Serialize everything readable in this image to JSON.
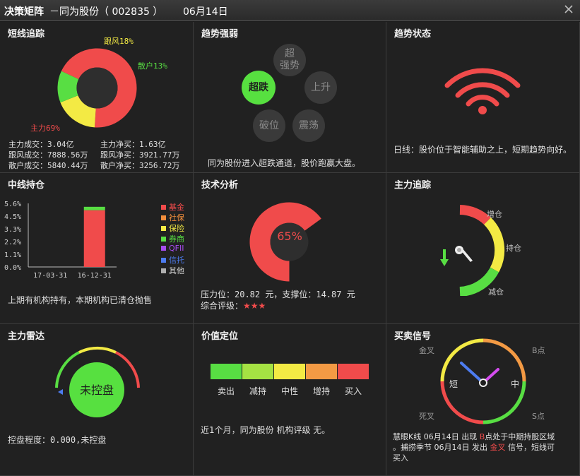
{
  "window": {
    "title": "决策矩阵",
    "stock": "－同为股份（ 002835 ）",
    "date": "06月14日"
  },
  "short_trend": {
    "title": "短线追踪",
    "slices": [
      {
        "name": "主力",
        "percent": 69,
        "label": "主力69%",
        "color": "#f04b4b"
      },
      {
        "name": "跟风",
        "percent": 18,
        "label": "跟风18%",
        "color": "#f3ea44"
      },
      {
        "name": "散户",
        "percent": 13,
        "label": "散户13%",
        "color": "#58de43"
      }
    ],
    "stats_left": [
      "主力成交：3.04亿",
      "跟风成交：7888.56万",
      "散户成交：5840.44万"
    ],
    "stats_right": [
      "主力净买：1.63亿",
      "跟风净买：3921.77万",
      "散户净买：3256.72万"
    ]
  },
  "trend_strength": {
    "title": "趋势强弱",
    "bubbles": {
      "super_strong": "超\n强势",
      "up": "上升",
      "super_down": "超跌",
      "break": "破位",
      "shock": "震荡"
    },
    "active": "super_down",
    "desc": "同为股份进入超跌通道，股价跑赢大盘。"
  },
  "trend_state": {
    "title": "趋势状态",
    "desc": "日线：股价位于智能辅助之上，短期趋势向好。",
    "signal_color": "#f04b4b"
  },
  "mid_position": {
    "title": "中线持仓",
    "yticks": [
      "5.6%",
      "4.5%",
      "3.3%",
      "2.2%",
      "1.1%",
      "0.0%"
    ],
    "desc": "上期有机构持有，本期机构已清仓抛售",
    "legend": [
      {
        "label": "基金",
        "color": "#f04b4b"
      },
      {
        "label": "社保",
        "color": "#f08d3c"
      },
      {
        "label": "保险",
        "color": "#f3ea44"
      },
      {
        "label": "券商",
        "color": "#58de43"
      },
      {
        "label": "QFII",
        "color": "#a64df0"
      },
      {
        "label": "信托",
        "color": "#4d7cf0"
      },
      {
        "label": "其他",
        "color": "#b0b0b0"
      }
    ]
  },
  "chart_data": {
    "type": "bar",
    "categories": [
      "17-03-31",
      "16-12-31"
    ],
    "series": [
      {
        "name": "基金",
        "values": [
          0,
          5.0
        ]
      },
      {
        "name": "券商",
        "values": [
          0,
          0.3
        ]
      }
    ],
    "ylim": [
      0,
      5.6
    ]
  },
  "tech_analysis": {
    "title": "技术分析",
    "percent": 65,
    "percent_label": "65%",
    "pressure": "压力位：20.82 元，支撑位：14.87 元",
    "rating_label": "综合评级：",
    "stars": "★★★"
  },
  "main_tracking": {
    "title": "主力追踪",
    "labels": {
      "add": "增仓",
      "hold": "持仓",
      "reduce": "减仓"
    },
    "arrow_color": "#58de43"
  },
  "main_radar": {
    "title": "主力雷达",
    "status": "未控盘",
    "desc": "控盘程度：0.000,未控盘"
  },
  "value_position": {
    "title": "价值定位",
    "scale": [
      {
        "label": "卖出",
        "color": "#58de43"
      },
      {
        "label": "减持",
        "color": "#a5e243"
      },
      {
        "label": "中性",
        "color": "#f3ea44"
      },
      {
        "label": "增持",
        "color": "#f39a44"
      },
      {
        "label": "买入",
        "color": "#f04b4b"
      }
    ],
    "desc": "近1个月，同为股份 机构评级 无。"
  },
  "trade_signal": {
    "title": "买卖信号",
    "labels": {
      "golden_cross": "金叉",
      "b_point": "B点",
      "short": "短",
      "mid": "中",
      "death_cross": "死叉",
      "s_point": "S点"
    },
    "line1_a": "慧眼K线 06月14日 出现 ",
    "line1_b": "B",
    "line1_c": "点处于中期持股区域",
    "line2_a": "。捕捞季节 06月14日 发出 ",
    "line2_b": "金叉",
    "line2_c": " 信号，短线可",
    "line3": "买入"
  }
}
